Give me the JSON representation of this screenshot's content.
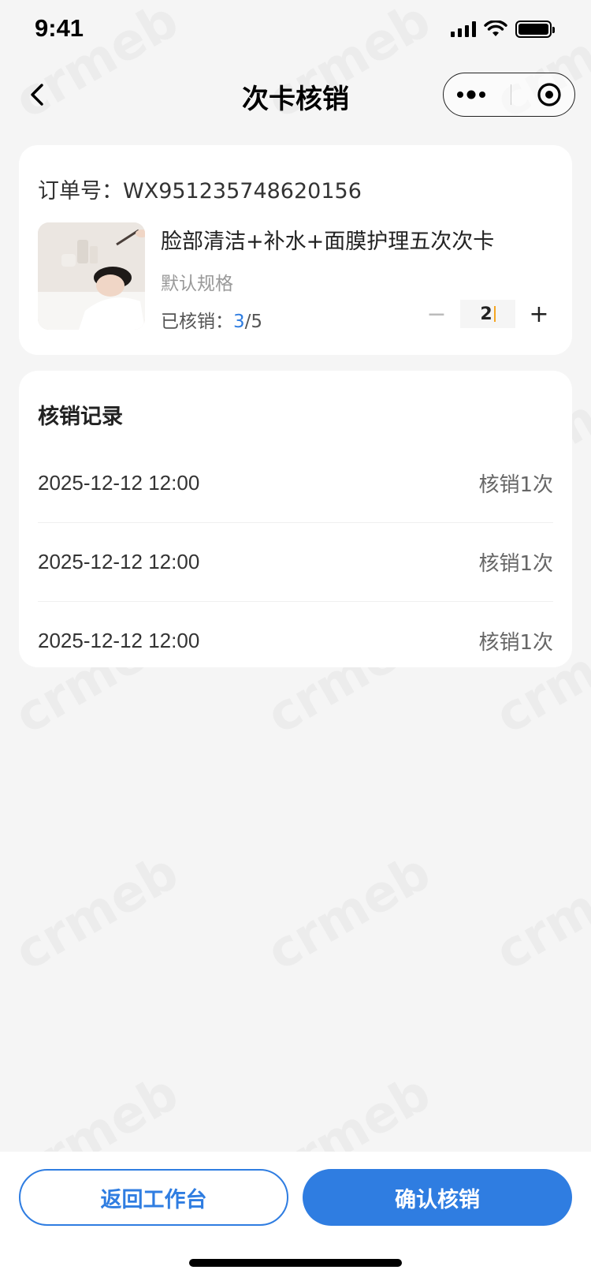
{
  "status_bar": {
    "time": "9:41"
  },
  "nav": {
    "title": "次卡核销"
  },
  "order": {
    "order_no": "订单号：WX951235748620156",
    "product_name": "脸部清洁+补水+面膜护理五次次卡",
    "spec": "默认规格",
    "verified_label": "已核销：",
    "verified_done": "3",
    "verified_total": "/5",
    "quantity": "2",
    "minus_symbol": "−",
    "plus_symbol": "+"
  },
  "records": {
    "title": "核销记录",
    "items": [
      {
        "date": "2025-12-12 12:00",
        "count": "核销1次"
      },
      {
        "date": "2025-12-12 12:00",
        "count": "核销1次"
      },
      {
        "date": "2025-12-12 12:00",
        "count": "核销1次"
      }
    ]
  },
  "buttons": {
    "back_label": "返回工作台",
    "confirm_label": "确认核销"
  },
  "colors": {
    "accent": "#2f7de1",
    "background": "#f5f5f5"
  },
  "icons": [
    "back-chevron-icon",
    "more-dots-icon",
    "target-close-icon",
    "signal-icon",
    "wifi-icon",
    "battery-icon"
  ]
}
